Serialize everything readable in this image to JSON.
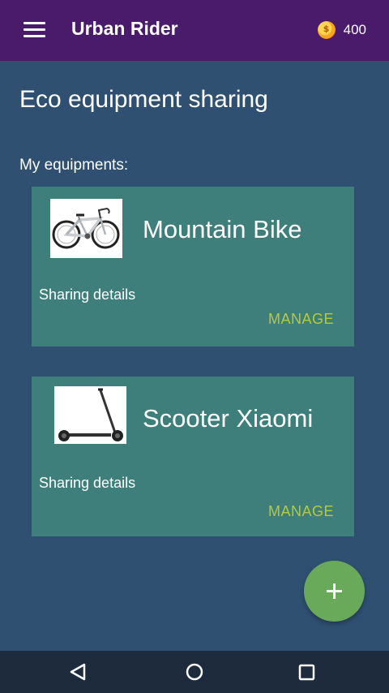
{
  "app": {
    "title": "Urban Rider",
    "coins": "400"
  },
  "page": {
    "title": "Eco equipment sharing",
    "section_label": "My equipments:"
  },
  "equipments": [
    {
      "name": "Mountain Bike",
      "details_label": "Sharing details",
      "action_label": "MANAGE",
      "image": "bicycle"
    },
    {
      "name": "Scooter Xiaomi",
      "details_label": "Sharing details",
      "action_label": "MANAGE",
      "image": "scooter"
    }
  ],
  "fab": {
    "icon": "plus-icon"
  },
  "system_nav": {
    "icons": [
      "back-icon",
      "home-icon",
      "recents-icon"
    ]
  },
  "colors": {
    "appbar": "#4a1a6b",
    "background": "#2f5071",
    "card": "#3e7e7b",
    "accent": "#b8c93a",
    "fab": "#69a95a"
  }
}
